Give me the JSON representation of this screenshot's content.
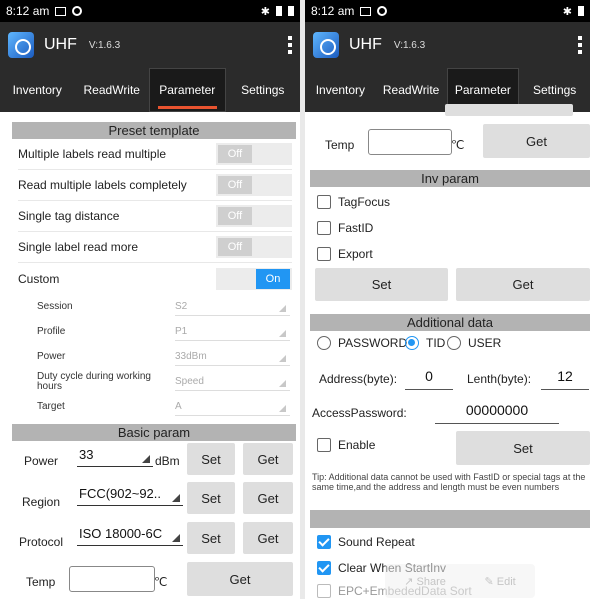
{
  "status": {
    "time": "8:12 am"
  },
  "app": {
    "title": "UHF",
    "version": "V:1.6.3"
  },
  "tabs": [
    "Inventory",
    "ReadWrite",
    "Parameter",
    "Settings"
  ],
  "left": {
    "preset": {
      "header": "Preset template",
      "rows": [
        {
          "label": "Multiple labels read multiple",
          "state": "Off"
        },
        {
          "label": "Read multiple labels completely",
          "state": "Off"
        },
        {
          "label": "Single tag distance",
          "state": "Off"
        },
        {
          "label": "Single label read more",
          "state": "Off"
        },
        {
          "label": "Custom",
          "state": "On"
        }
      ]
    },
    "settings": [
      {
        "label": "Session",
        "value": "S2"
      },
      {
        "label": "Profile",
        "value": "P1"
      },
      {
        "label": "Power",
        "value": "33dBm"
      },
      {
        "label": "Duty cycle during working hours",
        "value": "Speed"
      },
      {
        "label": "Target",
        "value": "A"
      }
    ],
    "basic": {
      "header": "Basic param",
      "power": {
        "label": "Power",
        "value": "33",
        "unit": "dBm",
        "set": "Set",
        "get": "Get"
      },
      "region": {
        "label": "Region",
        "value": "FCC(902~92..",
        "set": "Set",
        "get": "Get"
      },
      "protocol": {
        "label": "Protocol",
        "value": "ISO 18000-6C",
        "set": "Set",
        "get": "Get"
      },
      "temp": {
        "label": "Temp",
        "unit": "℃",
        "get": "Get"
      }
    }
  },
  "right": {
    "temp": {
      "label": "Temp",
      "unit": "℃",
      "get": "Get"
    },
    "inv": {
      "header": "Inv param",
      "tagfocus": "TagFocus",
      "fastid": "FastID",
      "export": "Export",
      "set": "Set",
      "get": "Get"
    },
    "add": {
      "header": "Additional data",
      "password": "PASSWORD",
      "tid": "TID",
      "user": "USER",
      "address_label": "Address(byte):",
      "address_value": "0",
      "length_label": "Lenth(byte):",
      "length_value": "12",
      "access_label": "AccessPassword:",
      "access_value": "00000000",
      "enable": "Enable",
      "set": "Set",
      "tip": "Tip: Additional data cannot be used with FastID or special tags at the same time,and the address and length must be even numbers"
    },
    "sound": "Sound Repeat",
    "clear": "Clear When StartInv",
    "epc": "EPC+EmbededData Sort",
    "share": "Share",
    "edit": "Edit"
  }
}
